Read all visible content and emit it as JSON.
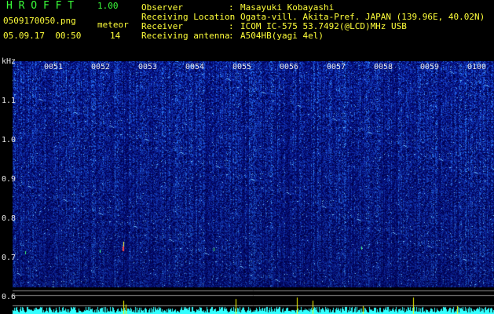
{
  "header": {
    "app_title": "H R O F F T",
    "app_version": "1.00",
    "file_name": "0509170050.png",
    "meteor_label": "meteor",
    "time": "05.09.17  00:50",
    "meteor_count": "14"
  },
  "info": [
    {
      "key": "Observer",
      "value": "Masayuki Kobayashi"
    },
    {
      "key": "Receiving Location",
      "value": "Ogata-vill. Akita-Pref. JAPAN (139.96E, 40.02N)"
    },
    {
      "key": "Receiver",
      "value": "ICOM IC-575 53.7492(@LCD)MHz USB"
    },
    {
      "key": "Receiving antenna",
      "value": "A504HB(yagi 4el)"
    }
  ],
  "separator": ":",
  "axis": {
    "unit": "kHz",
    "freq_ticks": [
      "1.1",
      "1.0",
      "0.9",
      "0.8",
      "0.7",
      "0.6"
    ],
    "time_ticks": [
      "0051",
      "0052",
      "0053",
      "0054",
      "0055",
      "0056",
      "0057",
      "0058",
      "0059",
      "0100"
    ]
  },
  "colors": {
    "background": "#000000",
    "spectrogram_base": "#0a1a8a",
    "text_green": "#3aff3a",
    "text_yellow": "#ffff3a",
    "signal_cyan": "#33ffff",
    "meteor_marker": "#ffff00"
  },
  "chart_data": {
    "type": "heatmap",
    "ylabel": "kHz",
    "y_ticks": [
      1.1,
      1.0,
      0.9,
      0.8,
      0.7,
      0.6
    ],
    "x_ticks": [
      "0051",
      "0052",
      "0053",
      "0054",
      "0055",
      "0056",
      "0057",
      "0058",
      "0059",
      "0100"
    ],
    "meteor_count": 14
  }
}
